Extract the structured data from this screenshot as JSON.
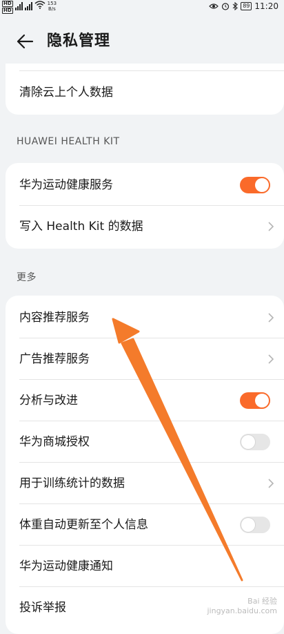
{
  "status_bar": {
    "net_speed_value": "153",
    "net_speed_unit": "B/s",
    "battery": "89",
    "time": "11:20",
    "icons": [
      "hd-icon",
      "signal-icon",
      "wifi-icon",
      "eye-icon",
      "alarm-icon",
      "bluetooth-icon",
      "battery-icon"
    ]
  },
  "header": {
    "title": "隐私管理"
  },
  "card1": {
    "items": [
      {
        "label": "清除云上个人数据",
        "control": "none"
      }
    ]
  },
  "section_kit": {
    "title": "HUAWEI HEALTH KIT"
  },
  "card2": {
    "items": [
      {
        "label": "华为运动健康服务",
        "control": "toggle",
        "on": true
      },
      {
        "label": "写入 Health Kit 的数据",
        "control": "chevron"
      }
    ]
  },
  "section_more": {
    "title": "更多"
  },
  "card3": {
    "items": [
      {
        "label": "内容推荐服务",
        "control": "chevron"
      },
      {
        "label": "广告推荐服务",
        "control": "chevron"
      },
      {
        "label": "分析与改进",
        "control": "toggle",
        "on": true
      },
      {
        "label": "华为商城授权",
        "control": "toggle",
        "on": false
      },
      {
        "label": "用于训练统计的数据",
        "control": "chevron"
      },
      {
        "label": "体重自动更新至个人信息",
        "control": "toggle",
        "on": false
      },
      {
        "label": "华为运动健康通知",
        "control": "none"
      },
      {
        "label": "投诉举报",
        "control": "none"
      }
    ]
  },
  "colors": {
    "accent": "#fa6a2a",
    "arrow": "#f47b2b",
    "background": "#f1f3f5"
  },
  "watermark": {
    "line1": "Bai 经验",
    "line2": "jingyan.baidu.com"
  }
}
